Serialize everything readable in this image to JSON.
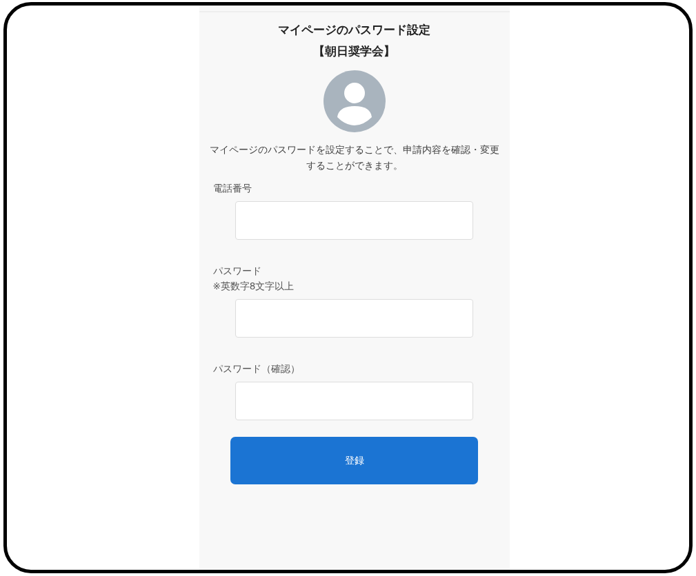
{
  "page": {
    "title": "マイページのパスワード設定",
    "subtitle": "【朝日奨学会】",
    "description": "マイページのパスワードを設定することで、申請内容を確認・変更することができます。"
  },
  "fields": [
    {
      "label": "電話番号"
    },
    {
      "label": "パスワード",
      "note": "※英数字8文字以上"
    },
    {
      "label": "パスワード（確認）"
    }
  ],
  "submit": {
    "label": "登録"
  }
}
